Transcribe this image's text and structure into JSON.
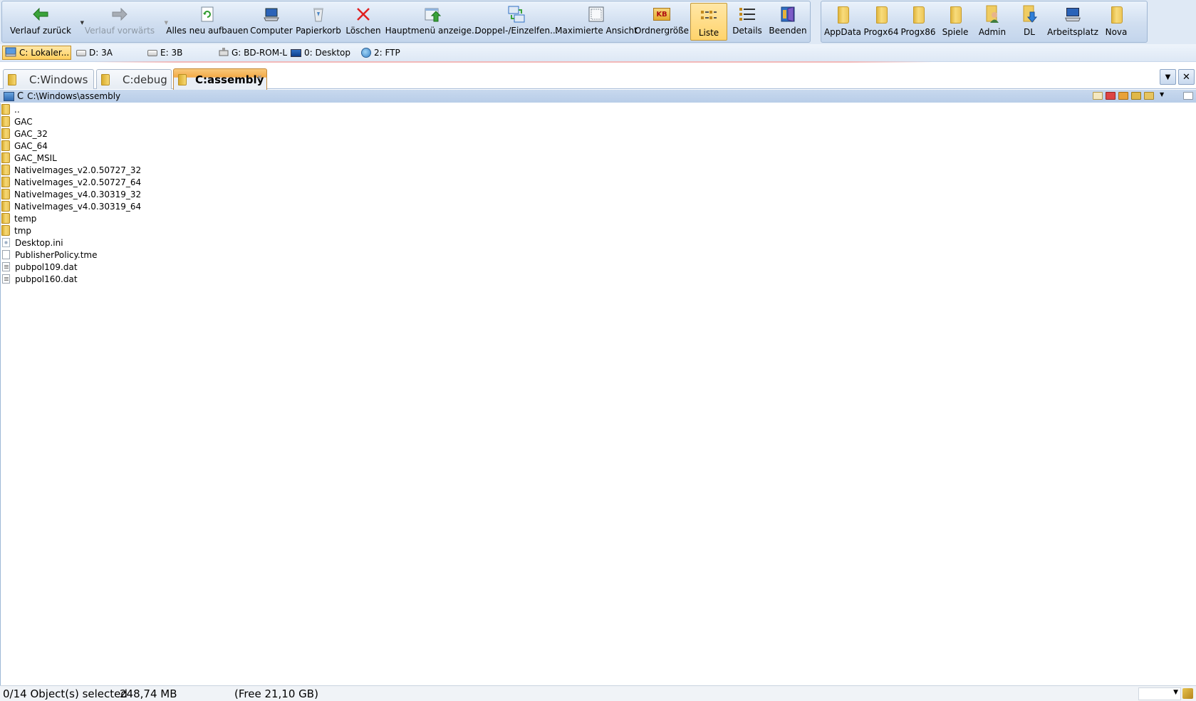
{
  "toolbar": {
    "back": {
      "label": "Verlauf zurück",
      "icon": "green-arrow-left-icon"
    },
    "forward": {
      "label": "Verlauf vorwärts",
      "icon": "gray-arrow-right-icon"
    },
    "refresh": {
      "label": "Alles neu aufbauen",
      "icon": "refresh-icon"
    },
    "computer": {
      "label": "Computer",
      "icon": "computer-icon"
    },
    "recycle": {
      "label": "Papierkorb",
      "icon": "recycle-bin-icon"
    },
    "delete": {
      "label": "Löschen",
      "icon": "red-x-icon"
    },
    "mainmenu": {
      "label": "Hauptmenü anzeige...",
      "icon": "main-menu-icon"
    },
    "dual": {
      "label": "Doppel-/Einzelfen...",
      "icon": "dual-pane-icon"
    },
    "maximize": {
      "label": "Maximierte Ansicht",
      "icon": "maximize-icon"
    },
    "foldersize": {
      "label": "Ordnergröße",
      "badge": "KB",
      "icon": "folder-size-icon"
    },
    "list": {
      "label": "Liste",
      "icon": "list-view-icon"
    },
    "details": {
      "label": "Details",
      "icon": "details-view-icon"
    },
    "exit": {
      "label": "Beenden",
      "icon": "exit-door-icon"
    }
  },
  "favorites": [
    {
      "label": "AppData",
      "icon": "folder-icon"
    },
    {
      "label": "Progx64",
      "icon": "folder-icon"
    },
    {
      "label": "Progx86",
      "icon": "folder-icon"
    },
    {
      "label": "Spiele",
      "icon": "folder-icon"
    },
    {
      "label": "Admin",
      "icon": "user-folder-icon"
    },
    {
      "label": "DL",
      "icon": "download-folder-icon"
    },
    {
      "label": "Arbeitsplatz",
      "icon": "computer-icon"
    },
    {
      "label": "Nova",
      "icon": "folder-icon"
    }
  ],
  "drives": [
    {
      "label": "C: Lokaler...",
      "active": true
    },
    {
      "label": "D: 3A"
    },
    {
      "label": "E: 3B"
    },
    {
      "label": "G: BD-ROM-La"
    },
    {
      "label": "0: Desktop"
    },
    {
      "label": "2: FTP"
    }
  ],
  "tabs": [
    {
      "label": "C:Windows"
    },
    {
      "label": "C:debug"
    },
    {
      "label": "C:assembly",
      "active": true
    }
  ],
  "tab_close_glyph": "×",
  "path": {
    "drive": "C",
    "text": "C:\\Windows\\assembly"
  },
  "files": [
    {
      "name": "..",
      "type": "folder"
    },
    {
      "name": "GAC",
      "type": "folder"
    },
    {
      "name": "GAC_32",
      "type": "folder"
    },
    {
      "name": "GAC_64",
      "type": "folder"
    },
    {
      "name": "GAC_MSIL",
      "type": "folder"
    },
    {
      "name": "NativeImages_v2.0.50727_32",
      "type": "folder"
    },
    {
      "name": "NativeImages_v2.0.50727_64",
      "type": "folder"
    },
    {
      "name": "NativeImages_v4.0.30319_32",
      "type": "folder"
    },
    {
      "name": "NativeImages_v4.0.30319_64",
      "type": "folder"
    },
    {
      "name": "temp",
      "type": "folder"
    },
    {
      "name": "tmp",
      "type": "folder"
    },
    {
      "name": "Desktop.ini",
      "type": "ini"
    },
    {
      "name": "PublisherPolicy.tme",
      "type": "file"
    },
    {
      "name": "pubpol109.dat",
      "type": "dat"
    },
    {
      "name": "pubpol160.dat",
      "type": "dat"
    }
  ],
  "status": {
    "selected": "0/14 Object(s) selected",
    "size": "248,74 MB",
    "free": "(Free 21,10 GB)"
  },
  "colors": {
    "toolbar_bg": "#d0def0",
    "active_highlight": "#ffd36c",
    "delete_red": "#e02020",
    "back_green": "#3aa33a"
  }
}
